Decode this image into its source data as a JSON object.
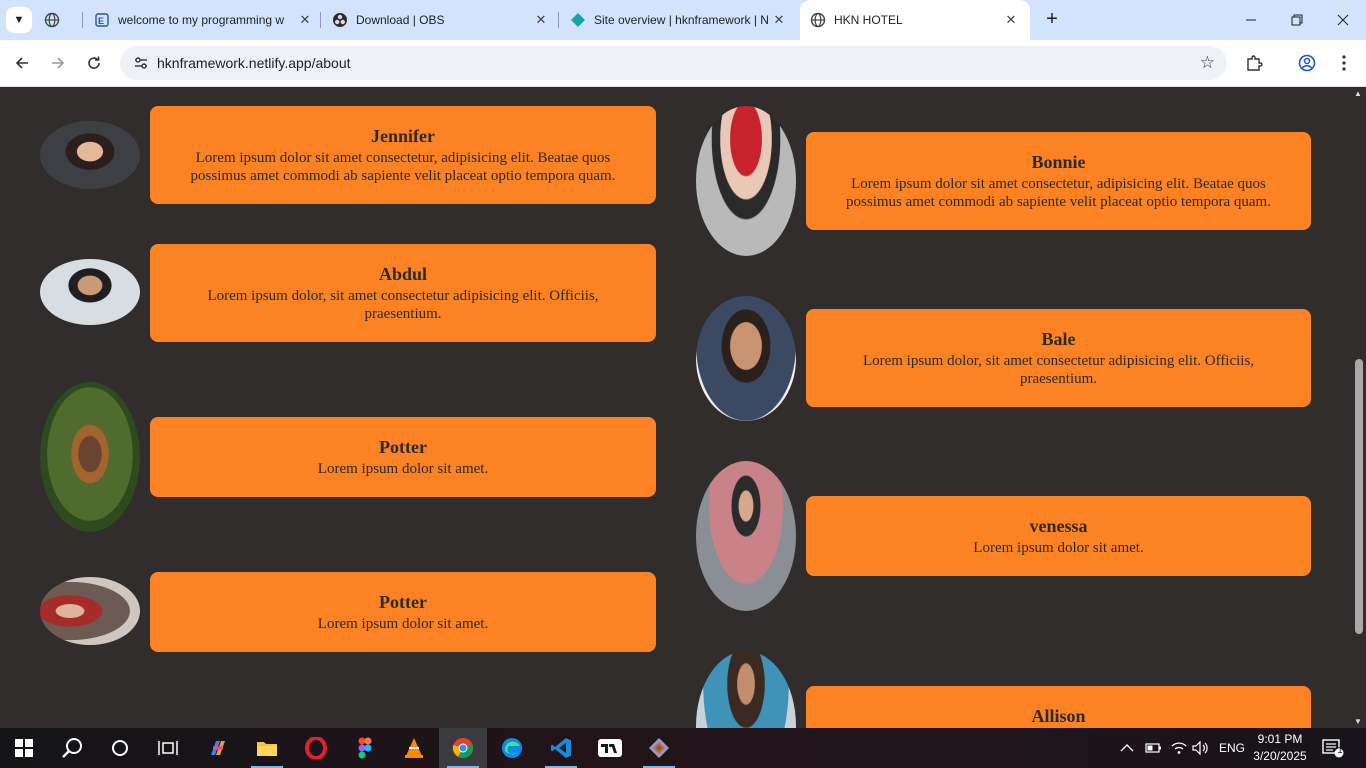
{
  "browser": {
    "tabs": [
      {
        "title": "welcome to my programming w",
        "favicon": "globe-icon"
      },
      {
        "title": "Download | OBS",
        "favicon": "obs-icon"
      },
      {
        "title": "Site overview | hknframework | N",
        "favicon": "netlify-icon"
      },
      {
        "title": "HKN HOTEL",
        "favicon": "globe-icon",
        "active": true
      }
    ],
    "url": "hknframework.netlify.app/about"
  },
  "team": {
    "left": [
      {
        "name": "Jennifer",
        "text": "Lorem ipsum dolor sit amet consectetur, adipisicing elit. Beatae quos possimus amet commodi ab sapiente velit placeat optio tempora quam."
      },
      {
        "name": "Abdul",
        "text": "Lorem ipsum dolor, sit amet consectetur adipisicing elit. Officiis, praesentium."
      },
      {
        "name": "Potter",
        "text": "Lorem ipsum dolor sit amet."
      },
      {
        "name": "Potter",
        "text": "Lorem ipsum dolor sit amet."
      }
    ],
    "right": [
      {
        "name": "Bonnie",
        "text": "Lorem ipsum dolor sit amet consectetur, adipisicing elit. Beatae quos possimus amet commodi ab sapiente velit placeat optio tempora quam."
      },
      {
        "name": "Bale",
        "text": "Lorem ipsum dolor, sit amet consectetur adipisicing elit. Officiis, praesentium."
      },
      {
        "name": "venessa",
        "text": "Lorem ipsum dolor sit amet."
      },
      {
        "name": "Allison",
        "text": ""
      }
    ]
  },
  "taskbar": {
    "language": "ENG",
    "time": "9:01 PM",
    "date": "3/20/2025",
    "notifications": "1"
  },
  "colors": {
    "card": "#fd8223",
    "page_bg": "#302d2c",
    "tabstrip": "#d3e3fd"
  }
}
